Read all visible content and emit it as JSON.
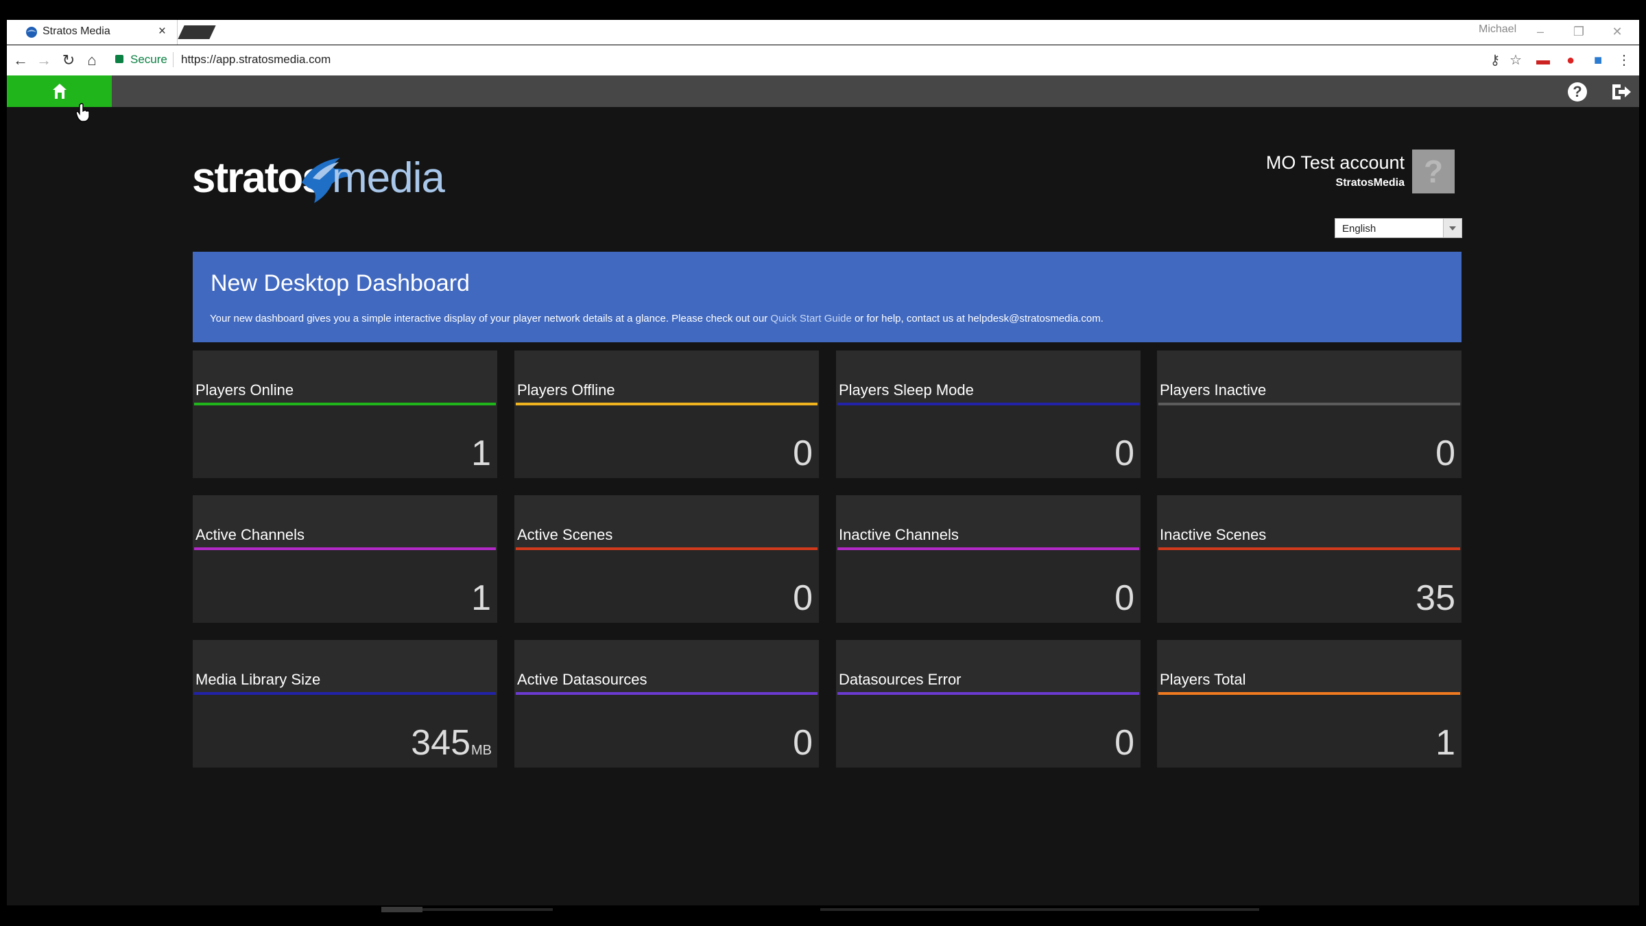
{
  "browser": {
    "tab_title": "Stratos Media",
    "tab_close": "×",
    "window_user": "Michael",
    "secure_label": "Secure",
    "url": "https://app.stratosmedia.com"
  },
  "header": {
    "account_name": "MO Test account",
    "organization": "StratosMedia",
    "avatar_glyph": "?",
    "language": "English",
    "logo_text_1": "stratos",
    "logo_text_2": "media"
  },
  "banner": {
    "title": "New Desktop Dashboard",
    "text_before": "Your new dashboard gives you a simple interactive display of your player network details at a glance. Please check out our ",
    "link_text": "Quick Start Guide",
    "text_after": " or for help, contact us at helpdesk@stratosmedia.com.",
    "color": "#4169c0"
  },
  "tiles": [
    {
      "label": "Players Online",
      "value": "1",
      "unit": "",
      "color": "#21b51c"
    },
    {
      "label": "Players Offline",
      "value": "0",
      "unit": "",
      "color": "#f0b320"
    },
    {
      "label": "Players Sleep Mode",
      "value": "0",
      "unit": "",
      "color": "#2222a8"
    },
    {
      "label": "Players Inactive",
      "value": "0",
      "unit": "",
      "color": "#5c5c5c"
    },
    {
      "label": "Active Channels",
      "value": "1",
      "unit": "",
      "color": "#b329c8"
    },
    {
      "label": "Active Scenes",
      "value": "0",
      "unit": "",
      "color": "#d13a1c"
    },
    {
      "label": "Inactive Channels",
      "value": "0",
      "unit": "",
      "color": "#b329c8"
    },
    {
      "label": "Inactive Scenes",
      "value": "35",
      "unit": "",
      "color": "#d13a1c"
    },
    {
      "label": "Media Library Size",
      "value": "345",
      "unit": "MB",
      "color": "#2222a8"
    },
    {
      "label": "Active Datasources",
      "value": "0",
      "unit": "",
      "color": "#6a3ad1"
    },
    {
      "label": "Datasources Error",
      "value": "0",
      "unit": "",
      "color": "#6a3ad1"
    },
    {
      "label": "Players Total",
      "value": "1",
      "unit": "",
      "color": "#f07a20"
    }
  ]
}
